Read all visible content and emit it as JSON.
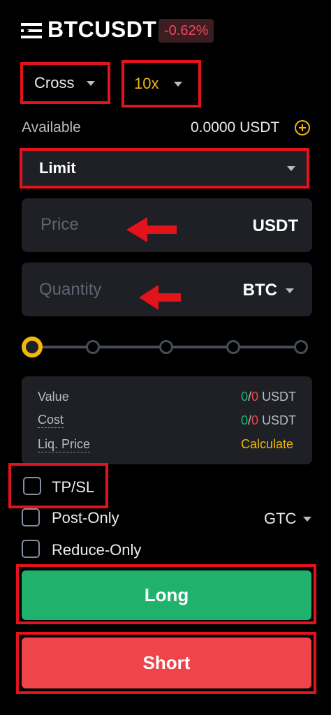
{
  "header": {
    "symbol": "BTCUSDT",
    "change": "-0.62%"
  },
  "margin_mode": {
    "value": "Cross"
  },
  "leverage": {
    "value": "10x"
  },
  "available": {
    "label": "Available",
    "value": "0.0000 USDT"
  },
  "order_type": {
    "value": "Limit"
  },
  "price": {
    "placeholder": "Price",
    "unit": "USDT"
  },
  "quantity": {
    "placeholder": "Quantity",
    "unit": "BTC"
  },
  "slider": {
    "stops": 5,
    "value_fraction": 0
  },
  "summary": {
    "value_label": "Value",
    "value_long": "0",
    "value_sep": "/",
    "value_short": "0",
    "value_unit": " USDT",
    "cost_label": "Cost",
    "cost_long": "0",
    "cost_sep": "/",
    "cost_short": "0",
    "cost_unit": " USDT",
    "liq_label": "Liq. Price",
    "liq_action": "Calculate"
  },
  "options": {
    "tpsl": "TP/SL",
    "post_only": "Post-Only",
    "reduce_only": "Reduce-Only",
    "time_in_force": "GTC"
  },
  "actions": {
    "long": "Long",
    "short": "Short"
  },
  "colors": {
    "long": "#20b26c",
    "short": "#ef454a",
    "accent": "#f0b90b",
    "highlight": "#e3131b"
  }
}
